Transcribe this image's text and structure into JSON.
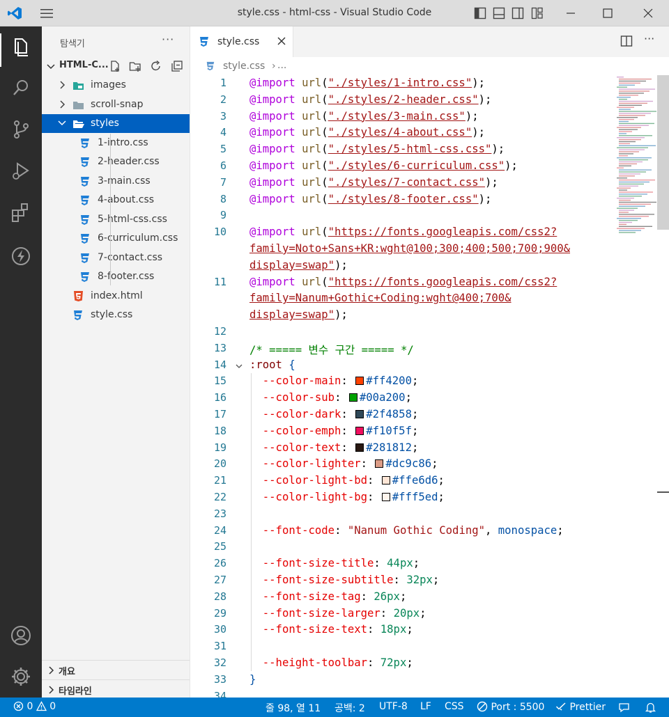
{
  "window": {
    "title": "style.css - html-css - Visual Studio Code"
  },
  "activity_bar": {
    "items": [
      "explorer-icon",
      "search-icon",
      "source-control-icon",
      "run-debug-icon",
      "extensions-icon",
      "thunder-icon"
    ],
    "bottom": [
      "account-icon",
      "settings-gear-icon"
    ]
  },
  "sidebar": {
    "header": "탐색기",
    "more": "···",
    "section_title": "HTML-C...",
    "tree": [
      {
        "label": "images",
        "type": "folder"
      },
      {
        "label": "scroll-snap",
        "type": "folder"
      },
      {
        "label": "styles",
        "type": "folder-open",
        "selected": true
      },
      {
        "label": "1-intro.css",
        "type": "css"
      },
      {
        "label": "2-header.css",
        "type": "css"
      },
      {
        "label": "3-main.css",
        "type": "css"
      },
      {
        "label": "4-about.css",
        "type": "css"
      },
      {
        "label": "5-html-css.css",
        "type": "css"
      },
      {
        "label": "6-curriculum.css",
        "type": "css"
      },
      {
        "label": "7-contact.css",
        "type": "css"
      },
      {
        "label": "8-footer.css",
        "type": "css"
      },
      {
        "label": "index.html",
        "type": "html"
      },
      {
        "label": "style.css",
        "type": "css"
      }
    ],
    "bottom_sections": [
      "개요",
      "타임라인"
    ]
  },
  "editor": {
    "tab_label": "style.css",
    "breadcrumb_file": "style.css",
    "breadcrumb_rest": "...",
    "lines": [
      {
        "n": "1",
        "parts": [
          [
            "k",
            "@import"
          ],
          [
            "p",
            " "
          ],
          [
            "f",
            "url"
          ],
          [
            "p",
            "("
          ],
          [
            "s",
            "\"./styles/1-intro.css\""
          ],
          [
            "p",
            ");"
          ]
        ]
      },
      {
        "n": "2",
        "parts": [
          [
            "k",
            "@import"
          ],
          [
            "p",
            " "
          ],
          [
            "f",
            "url"
          ],
          [
            "p",
            "("
          ],
          [
            "s",
            "\"./styles/2-header.css\""
          ],
          [
            "p",
            ");"
          ]
        ]
      },
      {
        "n": "3",
        "parts": [
          [
            "k",
            "@import"
          ],
          [
            "p",
            " "
          ],
          [
            "f",
            "url"
          ],
          [
            "p",
            "("
          ],
          [
            "s",
            "\"./styles/3-main.css\""
          ],
          [
            "p",
            ");"
          ]
        ]
      },
      {
        "n": "4",
        "parts": [
          [
            "k",
            "@import"
          ],
          [
            "p",
            " "
          ],
          [
            "f",
            "url"
          ],
          [
            "p",
            "("
          ],
          [
            "s",
            "\"./styles/4-about.css\""
          ],
          [
            "p",
            ");"
          ]
        ]
      },
      {
        "n": "5",
        "parts": [
          [
            "k",
            "@import"
          ],
          [
            "p",
            " "
          ],
          [
            "f",
            "url"
          ],
          [
            "p",
            "("
          ],
          [
            "s",
            "\"./styles/5-html-css.css\""
          ],
          [
            "p",
            ");"
          ]
        ]
      },
      {
        "n": "6",
        "parts": [
          [
            "k",
            "@import"
          ],
          [
            "p",
            " "
          ],
          [
            "f",
            "url"
          ],
          [
            "p",
            "("
          ],
          [
            "s",
            "\"./styles/6-curriculum.css\""
          ],
          [
            "p",
            ");"
          ]
        ]
      },
      {
        "n": "7",
        "parts": [
          [
            "k",
            "@import"
          ],
          [
            "p",
            " "
          ],
          [
            "f",
            "url"
          ],
          [
            "p",
            "("
          ],
          [
            "s",
            "\"./styles/7-contact.css\""
          ],
          [
            "p",
            ");"
          ]
        ]
      },
      {
        "n": "8",
        "parts": [
          [
            "k",
            "@import"
          ],
          [
            "p",
            " "
          ],
          [
            "f",
            "url"
          ],
          [
            "p",
            "("
          ],
          [
            "s",
            "\"./styles/8-footer.css\""
          ],
          [
            "p",
            ");"
          ]
        ]
      },
      {
        "n": "9",
        "parts": []
      },
      {
        "n": "10",
        "parts": [
          [
            "k",
            "@import"
          ],
          [
            "p",
            " "
          ],
          [
            "f",
            "url"
          ],
          [
            "p",
            "("
          ],
          [
            "s",
            "\"https://fonts.googleapis.com/css2?"
          ]
        ]
      },
      {
        "n": "",
        "parts": [
          [
            "s",
            "family=Noto+Sans+KR:wght@100;300;400;500;700;900&"
          ]
        ]
      },
      {
        "n": "",
        "parts": [
          [
            "s",
            "display=swap\""
          ],
          [
            "p",
            ");"
          ]
        ]
      },
      {
        "n": "11",
        "parts": [
          [
            "k",
            "@import"
          ],
          [
            "p",
            " "
          ],
          [
            "f",
            "url"
          ],
          [
            "p",
            "("
          ],
          [
            "s",
            "\"https://fonts.googleapis.com/css2?"
          ]
        ]
      },
      {
        "n": "",
        "parts": [
          [
            "s",
            "family=Nanum+Gothic+Coding:wght@400;700&"
          ]
        ]
      },
      {
        "n": "",
        "parts": [
          [
            "s",
            "display=swap\""
          ],
          [
            "p",
            ");"
          ]
        ]
      },
      {
        "n": "12",
        "parts": []
      },
      {
        "n": "13",
        "parts": [
          [
            "c",
            "/* ===== 변수 구간 ===== */"
          ]
        ]
      },
      {
        "n": "14",
        "fold": true,
        "parts": [
          [
            "sel",
            ":root"
          ],
          [
            "p",
            " "
          ],
          [
            "val",
            "{"
          ]
        ]
      },
      {
        "n": "15",
        "parts": [
          [
            "p",
            "  "
          ],
          [
            "prop",
            "--color-main"
          ],
          [
            "p",
            ": "
          ],
          [
            "sw",
            "#ff4200"
          ],
          [
            "val",
            "#ff4200"
          ],
          [
            "p",
            ";"
          ]
        ]
      },
      {
        "n": "16",
        "parts": [
          [
            "p",
            "  "
          ],
          [
            "prop",
            "--color-sub"
          ],
          [
            "p",
            ": "
          ],
          [
            "sw",
            "#00a200"
          ],
          [
            "val",
            "#00a200"
          ],
          [
            "p",
            ";"
          ]
        ]
      },
      {
        "n": "17",
        "parts": [
          [
            "p",
            "  "
          ],
          [
            "prop",
            "--color-dark"
          ],
          [
            "p",
            ": "
          ],
          [
            "sw",
            "#2f4858"
          ],
          [
            "val",
            "#2f4858"
          ],
          [
            "p",
            ";"
          ]
        ]
      },
      {
        "n": "18",
        "parts": [
          [
            "p",
            "  "
          ],
          [
            "prop",
            "--color-emph"
          ],
          [
            "p",
            ": "
          ],
          [
            "sw",
            "#f10f5f"
          ],
          [
            "val",
            "#f10f5f"
          ],
          [
            "p",
            ";"
          ]
        ]
      },
      {
        "n": "19",
        "parts": [
          [
            "p",
            "  "
          ],
          [
            "prop",
            "--color-text"
          ],
          [
            "p",
            ": "
          ],
          [
            "sw",
            "#281812"
          ],
          [
            "val",
            "#281812"
          ],
          [
            "p",
            ";"
          ]
        ]
      },
      {
        "n": "20",
        "parts": [
          [
            "p",
            "  "
          ],
          [
            "prop",
            "--color-lighter"
          ],
          [
            "p",
            ": "
          ],
          [
            "sw",
            "#dc9c86"
          ],
          [
            "val",
            "#dc9c86"
          ],
          [
            "p",
            ";"
          ]
        ]
      },
      {
        "n": "21",
        "parts": [
          [
            "p",
            "  "
          ],
          [
            "prop",
            "--color-light-bd"
          ],
          [
            "p",
            ": "
          ],
          [
            "sw",
            "#ffe6d6"
          ],
          [
            "val",
            "#ffe6d6"
          ],
          [
            "p",
            ";"
          ]
        ]
      },
      {
        "n": "22",
        "parts": [
          [
            "p",
            "  "
          ],
          [
            "prop",
            "--color-light-bg"
          ],
          [
            "p",
            ": "
          ],
          [
            "sw",
            "#fff5ed"
          ],
          [
            "val",
            "#fff5ed"
          ],
          [
            "p",
            ";"
          ]
        ]
      },
      {
        "n": "23",
        "parts": []
      },
      {
        "n": "24",
        "parts": [
          [
            "p",
            "  "
          ],
          [
            "prop",
            "--font-code"
          ],
          [
            "p",
            ": "
          ],
          [
            "str",
            "\"Nanum Gothic Coding\""
          ],
          [
            "p",
            ", "
          ],
          [
            "val",
            "monospace"
          ],
          [
            "p",
            ";"
          ]
        ]
      },
      {
        "n": "25",
        "parts": []
      },
      {
        "n": "26",
        "parts": [
          [
            "p",
            "  "
          ],
          [
            "prop",
            "--font-size-title"
          ],
          [
            "p",
            ": "
          ],
          [
            "num",
            "44px"
          ],
          [
            "p",
            ";"
          ]
        ]
      },
      {
        "n": "27",
        "parts": [
          [
            "p",
            "  "
          ],
          [
            "prop",
            "--font-size-subtitle"
          ],
          [
            "p",
            ": "
          ],
          [
            "num",
            "32px"
          ],
          [
            "p",
            ";"
          ]
        ]
      },
      {
        "n": "28",
        "parts": [
          [
            "p",
            "  "
          ],
          [
            "prop",
            "--font-size-tag"
          ],
          [
            "p",
            ": "
          ],
          [
            "num",
            "26px"
          ],
          [
            "p",
            ";"
          ]
        ]
      },
      {
        "n": "29",
        "parts": [
          [
            "p",
            "  "
          ],
          [
            "prop",
            "--font-size-larger"
          ],
          [
            "p",
            ": "
          ],
          [
            "num",
            "20px"
          ],
          [
            "p",
            ";"
          ]
        ]
      },
      {
        "n": "30",
        "parts": [
          [
            "p",
            "  "
          ],
          [
            "prop",
            "--font-size-text"
          ],
          [
            "p",
            ": "
          ],
          [
            "num",
            "18px"
          ],
          [
            "p",
            ";"
          ]
        ]
      },
      {
        "n": "31",
        "parts": []
      },
      {
        "n": "32",
        "parts": [
          [
            "p",
            "  "
          ],
          [
            "prop",
            "--height-toolbar"
          ],
          [
            "p",
            ": "
          ],
          [
            "num",
            "72px"
          ],
          [
            "p",
            ";"
          ]
        ]
      },
      {
        "n": "33",
        "parts": [
          [
            "val",
            "}"
          ]
        ]
      },
      {
        "n": "34",
        "parts": []
      }
    ]
  },
  "status_bar": {
    "errors": "0",
    "warnings": "0",
    "position": "줄 98, 열 11",
    "indent": "공백: 2",
    "encoding": "UTF-8",
    "eol": "LF",
    "language": "CSS",
    "port": "Port : 5500",
    "prettier": "Prettier"
  },
  "colors": {
    "status_bar": "#007acc",
    "activity_bar": "#2c2c2c",
    "selection": "#0060c0"
  }
}
